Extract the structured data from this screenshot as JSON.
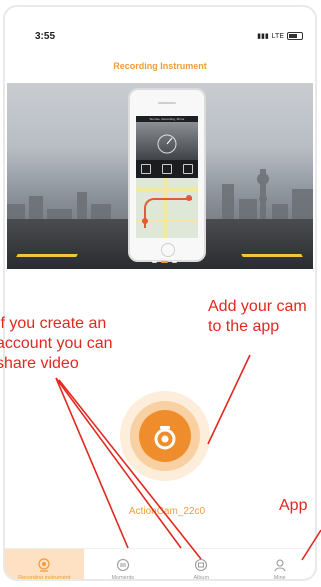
{
  "status": {
    "time": "3:55",
    "network": "LTE"
  },
  "app": {
    "title": "Recording Instrument",
    "screen_header": "Sunrise, Recording, Mirror"
  },
  "device": {
    "name": "ActionCam_22c0"
  },
  "tabs": [
    {
      "label": "Recording instrument",
      "icon": "camera-icon",
      "active": true
    },
    {
      "label": "Moments",
      "icon": "share-icon",
      "active": false
    },
    {
      "label": "Album",
      "icon": "album-icon",
      "active": false
    },
    {
      "label": "Mine",
      "icon": "person-icon",
      "active": false
    }
  ],
  "annotations": {
    "left_line1": "If you create an",
    "left_line2": "account you can",
    "left_line3": "share video",
    "right_line1": "Add your cam",
    "right_line2": "to the app",
    "app_label": "App"
  },
  "colors": {
    "accent": "#f29b3a",
    "annotation": "#e1281f"
  }
}
